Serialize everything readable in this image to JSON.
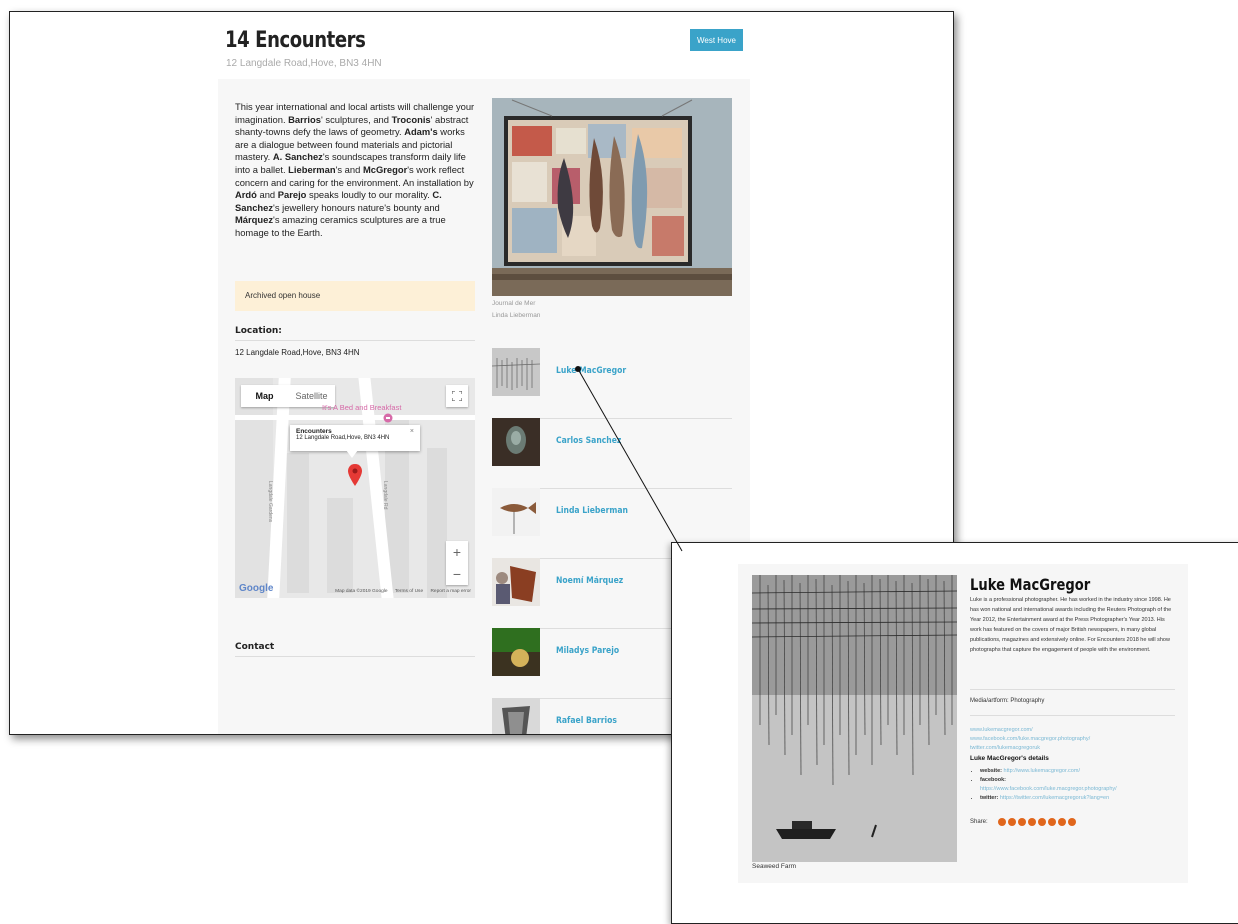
{
  "page": {
    "title": "14 Encounters",
    "address": "12 Langdale Road,Hove, BN3 4HN",
    "area_button": "West Hove",
    "description_parts": [
      {
        "t": "This year international and local artists will challenge your imagination. ",
        "b": false
      },
      {
        "t": "Barrios",
        "b": true
      },
      {
        "t": "' sculptures, and ",
        "b": false
      },
      {
        "t": "Troconis",
        "b": true
      },
      {
        "t": "' abstract shanty-towns defy the laws of geometry. ",
        "b": false
      },
      {
        "t": "Adam's",
        "b": true
      },
      {
        "t": " works are a dialogue between found materials and pictorial mastery. ",
        "b": false
      },
      {
        "t": "A. Sanchez",
        "b": true
      },
      {
        "t": "'s soundscapes transform daily life into a ballet. ",
        "b": false
      },
      {
        "t": "Lieberman",
        "b": true
      },
      {
        "t": "'s and ",
        "b": false
      },
      {
        "t": "McGregor",
        "b": true
      },
      {
        "t": "'s work reflect concern and caring for the environment. An installation by ",
        "b": false
      },
      {
        "t": "Ardó",
        "b": true
      },
      {
        "t": " and ",
        "b": false
      },
      {
        "t": "Parejo",
        "b": true
      },
      {
        "t": " speaks loudly to our morality. ",
        "b": false
      },
      {
        "t": "C. Sanchez",
        "b": true
      },
      {
        "t": "'s jewellery honours nature's bounty and ",
        "b": false
      },
      {
        "t": "Márquez",
        "b": true
      },
      {
        "t": "'s amazing ceramics sculptures are a true homage to the Earth.",
        "b": false
      }
    ],
    "archived_notice": "Archived open house",
    "location_heading": "Location:",
    "location_address": "12 Langdale Road,Hove, BN3 4HN",
    "contact_heading": "Contact"
  },
  "map": {
    "tab_map": "Map",
    "tab_satellite": "Satellite",
    "poi_label": "It's A Bed and Breakfast",
    "popup_title": "Encounters",
    "popup_address": "12 Langdale Road,Hove, BN3 4HN",
    "popup_close": "×",
    "street_left": "Langdale Gardens",
    "street_right": "Langdale Rd",
    "zoom_in": "+",
    "zoom_out": "−",
    "google": "Google",
    "map_data": "Map data ©2019 Google",
    "terms": "Terms of Use",
    "report": "Report a map error"
  },
  "hero": {
    "caption_title": "Journal de Mer",
    "caption_artist": "Linda Lieberman"
  },
  "artists": [
    {
      "name": "Luke MacGregor",
      "thumb": "reeds"
    },
    {
      "name": "Carlos Sanchez",
      "thumb": "jewel"
    },
    {
      "name": "Linda Lieberman",
      "thumb": "fish"
    },
    {
      "name": "Noemí Márquez",
      "thumb": "ceramic"
    },
    {
      "name": "Miladys Parejo",
      "thumb": "green"
    },
    {
      "name": "Rafael Barrios",
      "thumb": "sculpt"
    }
  ],
  "detail": {
    "name": "Luke MacGregor",
    "bio": "Luke is a professional photographer. He has worked in the industry since 1998. He has won national and international awards including the Reuters Photograph of the Year 2012, the Entertainment award at the Press Photographer's Year 2013. His work has featured on the covers of major British newspapers, in many global publications, magazines and extensively online. For Encounters 2018 he will show photographs that capture the engagement of people with the environment.",
    "medium": "Media/artform: Photography",
    "links": [
      "www.lukemacgregor.com/",
      "www.facebook.com/luke.macgregor.photography/",
      "twitter.com/lukemacgregoruk"
    ],
    "details_heading": "Luke MacGregor's details",
    "website_label": "website:",
    "website_url": "http://www.lukemacgregor.com/",
    "facebook_label": "facebook:",
    "facebook_url": "https://www.facebook.com/luke.macgregor.photography/",
    "twitter_label": "twitter:",
    "twitter_url": "https://twitter.com/lukemacgregoruk?lang=en",
    "share_label": "Share:",
    "share_icons": [
      "facebook-icon",
      "twitter-icon",
      "pinterest-icon",
      "google-plus-icon",
      "linkedin-icon",
      "tumblr-icon",
      "reddit-icon",
      "email-icon"
    ],
    "photo_caption": "Seaweed Farm"
  },
  "colors": {
    "accent": "#3aa3c9",
    "archived_bg": "#fdf0d7",
    "share": "#e0661c",
    "pin": "#e53935"
  }
}
